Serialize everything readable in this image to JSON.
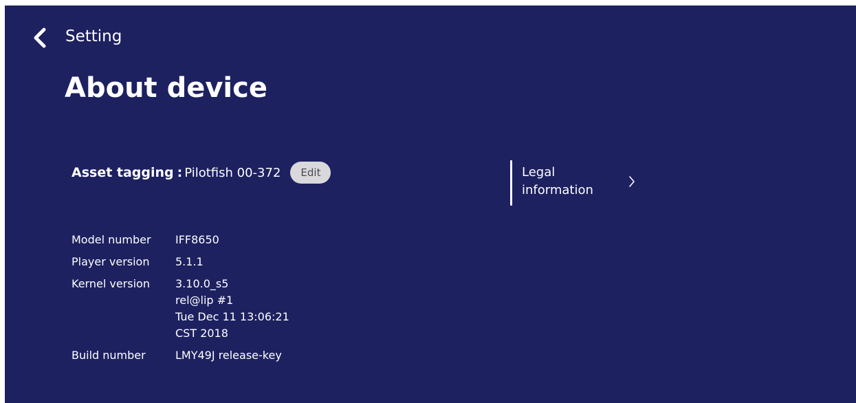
{
  "colors": {
    "background": "#1d2160",
    "text": "#ffffff",
    "edit_button_bg": "#d9d9dc",
    "edit_button_text": "#4a4a52"
  },
  "header": {
    "back_icon": "chevron-left-icon",
    "title": "Setting"
  },
  "page_title": "About device",
  "asset_tagging": {
    "label": "Asset tagging",
    "separator": ":",
    "value": "Pilotfish 00-372",
    "edit_label": "Edit"
  },
  "info": [
    {
      "label": "Model number",
      "value": [
        "IFF8650"
      ]
    },
    {
      "label": "Player version",
      "value": [
        "5.1.1"
      ]
    },
    {
      "label": "Kernel version",
      "value": [
        "3.10.0_s5",
        "rel@lip #1",
        "Tue Dec 11 13:06:21",
        "CST 2018"
      ]
    },
    {
      "label": "Build number",
      "value": [
        "LMY49J release-key"
      ]
    }
  ],
  "legal": {
    "label": "Legal information",
    "icon": "chevron-right-icon"
  }
}
